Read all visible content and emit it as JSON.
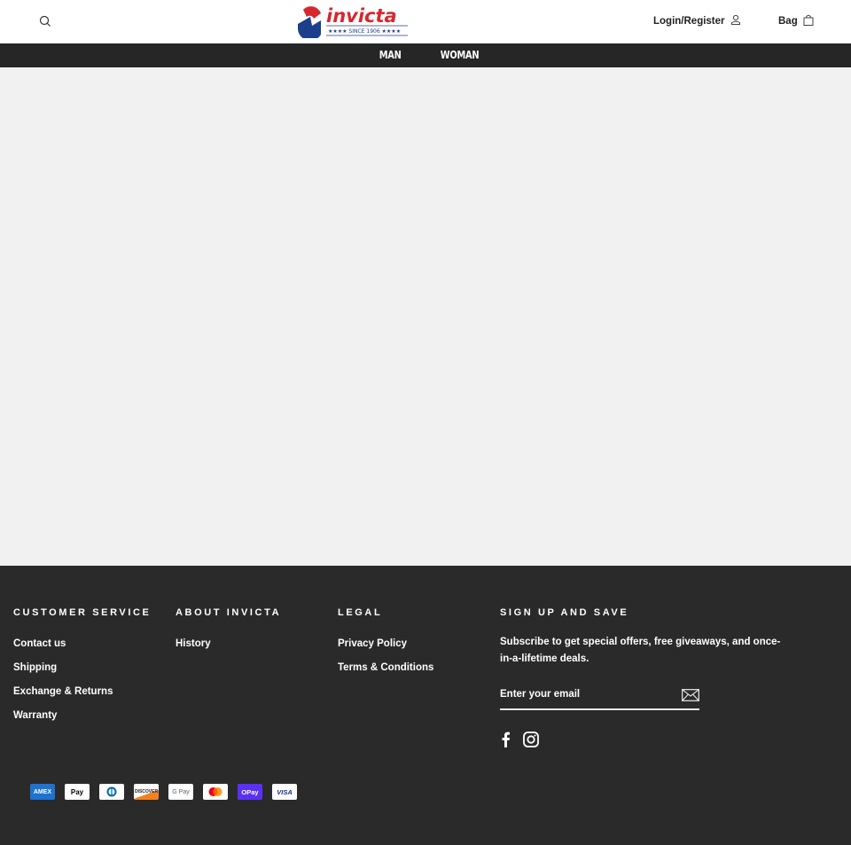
{
  "header": {
    "brand": "invicta",
    "tagline": "★★★★ SINCE 1906 ★★★★",
    "login_label": "Login/Register",
    "bag_label": "Bag"
  },
  "nav": {
    "items": [
      {
        "label": "MAN"
      },
      {
        "label": "WOMAN"
      }
    ]
  },
  "footer": {
    "customer_service": {
      "title": "CUSTOMER SERVICE",
      "links": [
        "Contact us",
        "Shipping",
        "Exchange & Returns",
        "Warranty"
      ]
    },
    "about": {
      "title": "ABOUT INVICTA",
      "links": [
        "History"
      ]
    },
    "legal": {
      "title": "LEGAL",
      "links": [
        "Privacy Policy",
        "Terms & Conditions"
      ]
    },
    "signup": {
      "title": "SIGN UP AND SAVE",
      "text": "Subscribe to get special offers, free giveaways, and once-in-a-lifetime deals.",
      "email_placeholder": "Enter your email",
      "email_value": ""
    },
    "payments": [
      {
        "name": "American Express",
        "label": "AMEX"
      },
      {
        "name": "Apple Pay",
        "label": " Pay"
      },
      {
        "name": "Diners Club",
        "label": "D"
      },
      {
        "name": "Discover",
        "label": "DISCOVER"
      },
      {
        "name": "Google Pay",
        "label": "G Pay"
      },
      {
        "name": "Mastercard",
        "label": ""
      },
      {
        "name": "Shop Pay",
        "label": "OPay"
      },
      {
        "name": "Visa",
        "label": "VISA"
      }
    ]
  },
  "colors": {
    "brand_red": "#d7272e",
    "brand_blue": "#1c3f8c",
    "nav_bg": "#262626",
    "footer_bg": "#2a2a2a",
    "main_bg": "#f1f1f1"
  }
}
